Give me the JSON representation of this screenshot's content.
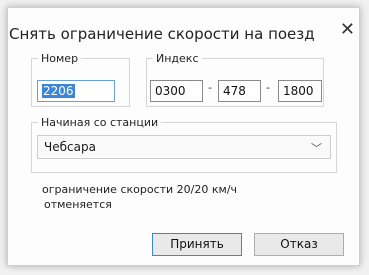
{
  "dialog": {
    "title": "Снять ограничение скорости на поезд",
    "close_glyph": "✕"
  },
  "number": {
    "legend": "Номер",
    "value": "2206"
  },
  "index": {
    "legend": "Индекс",
    "part1": "0300",
    "part2": "478",
    "part3": "1800",
    "separator": "-"
  },
  "station": {
    "legend": "Начиная со станции",
    "selected": "Чебсара",
    "chevron_icon": "chevron-down-icon"
  },
  "note": {
    "line1": "ограничение скорости 20/20 км/ч",
    "line2": "отменяется"
  },
  "buttons": {
    "ok": "Принять",
    "cancel": "Отказ"
  },
  "colors": {
    "accent": "#3b86d8",
    "selection_bg": "#3b86d8"
  }
}
